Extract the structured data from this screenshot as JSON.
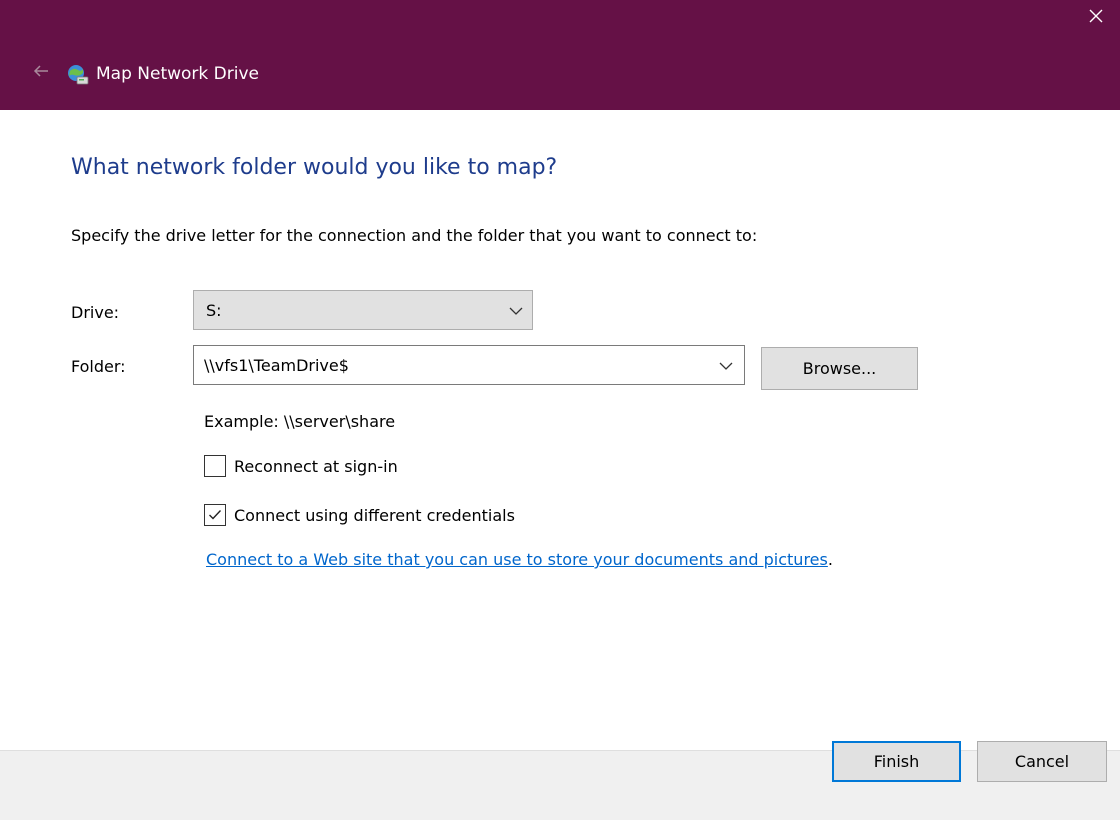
{
  "window": {
    "title": "Map Network Drive",
    "accent_color": "#651146",
    "icons": {
      "back": "back-arrow-icon",
      "app": "network-drive-icon",
      "close": "close-icon"
    }
  },
  "content": {
    "heading": "What network folder would you like to map?",
    "instruction": "Specify the drive letter for the connection and the folder that you want to connect to:",
    "drive": {
      "label": "Drive:",
      "value": "S:"
    },
    "folder": {
      "label": "Folder:",
      "value": "\\\\vfs1\\TeamDrive$",
      "browse_label": "Browse..."
    },
    "example": "Example: \\\\server\\share",
    "reconnect": {
      "label": "Reconnect at sign-in",
      "checked": false
    },
    "credentials": {
      "label": "Connect using different credentials",
      "checked": true
    },
    "web_link": {
      "text": "Connect to a Web site that you can use to store your documents and pictures",
      "suffix": "."
    }
  },
  "footer": {
    "finish_label": "Finish",
    "cancel_label": "Cancel"
  }
}
